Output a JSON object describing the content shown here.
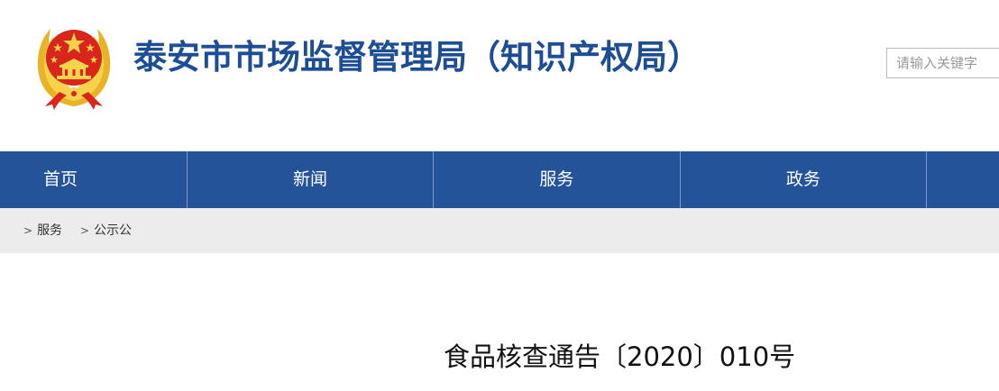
{
  "header": {
    "site_title": "泰安市市场监督管理局（知识产权局）",
    "search_placeholder": "请输入关键字",
    "emblem_icon": "national-emblem-icon"
  },
  "nav": {
    "items": [
      {
        "label": "首页"
      },
      {
        "label": "新闻"
      },
      {
        "label": "服务"
      },
      {
        "label": "政务"
      }
    ]
  },
  "breadcrumb": {
    "arrow": ">",
    "items": [
      {
        "label": "服务"
      },
      {
        "label": "公示公"
      }
    ]
  },
  "article": {
    "title": "食品核查通告〔2020〕010号"
  },
  "colors": {
    "brand_blue": "#1d4e95",
    "nav_blue": "#24539a",
    "breadcrumb_bg": "#ececec",
    "emblem_red": "#d9261c",
    "emblem_gold": "#f2c230"
  }
}
